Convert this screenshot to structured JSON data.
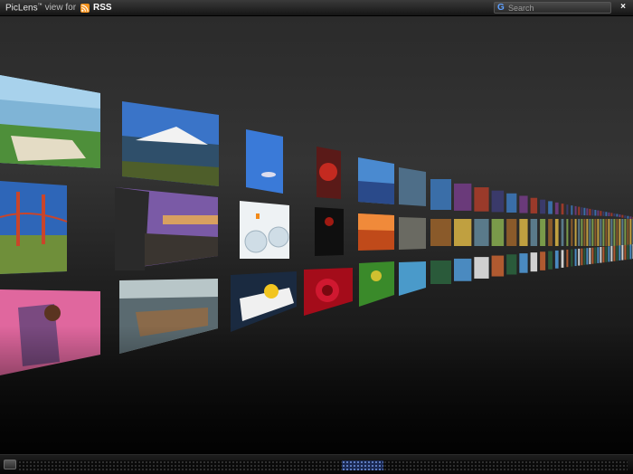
{
  "titlebar": {
    "brand": "PicLens",
    "trademark": "™",
    "view_for": "view for",
    "feed_label": "RSS",
    "rss_icon": "rss-feed-icon",
    "rss_color": "#f7931e"
  },
  "search": {
    "engine_icon": "google-g-icon",
    "engine_letter": "G",
    "placeholder": "Search"
  },
  "close": {
    "label": "×"
  },
  "wall": {
    "thumbnails": [
      {
        "name": "golf-course"
      },
      {
        "name": "snowy-mountain-lake"
      },
      {
        "name": "boat-on-blue-water"
      },
      {
        "name": "red-haired-portrait"
      },
      {
        "name": "lake-mountains"
      },
      {
        "name": "golden-gate-bridge"
      },
      {
        "name": "rocky-shore-sunset"
      },
      {
        "name": "fish-bowls"
      },
      {
        "name": "dark-red-figure"
      },
      {
        "name": "red-sunset"
      },
      {
        "name": "girl-on-pink-wall"
      },
      {
        "name": "city-river-view"
      },
      {
        "name": "splash-blue-yellow"
      },
      {
        "name": "red-rose"
      },
      {
        "name": "green-field"
      }
    ]
  },
  "colors": {
    "accent_handle": "#1b2a55",
    "background": "#2a2a2a"
  }
}
